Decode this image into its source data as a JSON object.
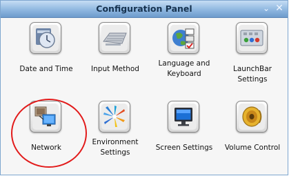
{
  "window": {
    "title": "Configuration Panel",
    "controls": {
      "minimize_icon": "minimize-icon",
      "close_icon": "close-icon",
      "minimize_glyph": "⌄",
      "close_glyph": "✕"
    }
  },
  "items": [
    {
      "label": "Date and Time",
      "icon": "clock-icon"
    },
    {
      "label": "Input Method",
      "icon": "keyboard-icon"
    },
    {
      "label": "Language and Keyboard",
      "icon": "globe-flags-icon"
    },
    {
      "label": "LaunchBar Settings",
      "icon": "launchbar-icon"
    },
    {
      "label": "Network",
      "icon": "network-icon"
    },
    {
      "label": "Environment Settings",
      "icon": "environment-icon"
    },
    {
      "label": "Screen Settings",
      "icon": "monitor-icon"
    },
    {
      "label": "Volume Control",
      "icon": "speaker-icon"
    }
  ],
  "colors": {
    "titlebar": "#8fb7e0",
    "highlight_circle": "#e21b1b"
  }
}
